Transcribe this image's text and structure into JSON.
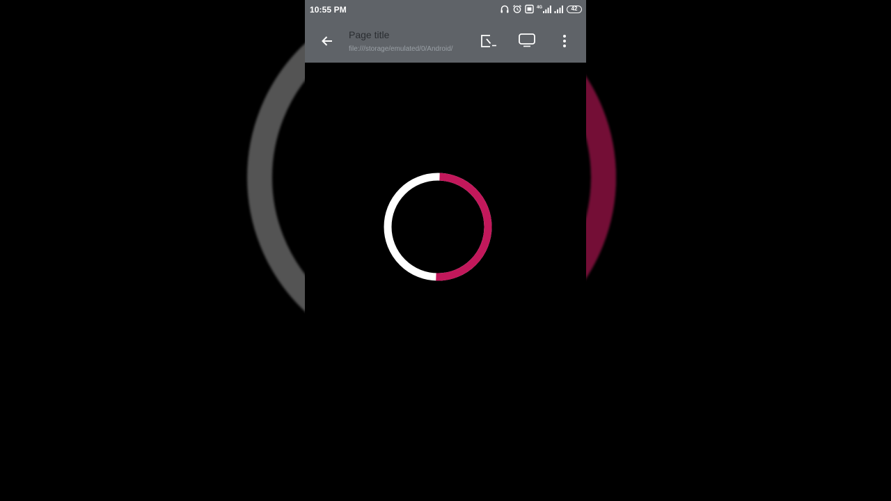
{
  "status_bar": {
    "time": "10:55 PM",
    "network_label": "4G",
    "battery_level": "42"
  },
  "toolbar": {
    "title": "Page title",
    "url": "file:///storage/emulated/0/Android/",
    "icons": {
      "back": "arrow-left-icon",
      "open_external": "open-external-icon",
      "tabs": "tab-switcher-icon",
      "menu": "more-vert-icon"
    }
  },
  "loader": {
    "progress": 0.5,
    "colors": {
      "progress": "#c2185b",
      "track": "#ffffff"
    }
  },
  "colors": {
    "toolbar_bg": "#5f6368",
    "page_bg": "#000000"
  }
}
